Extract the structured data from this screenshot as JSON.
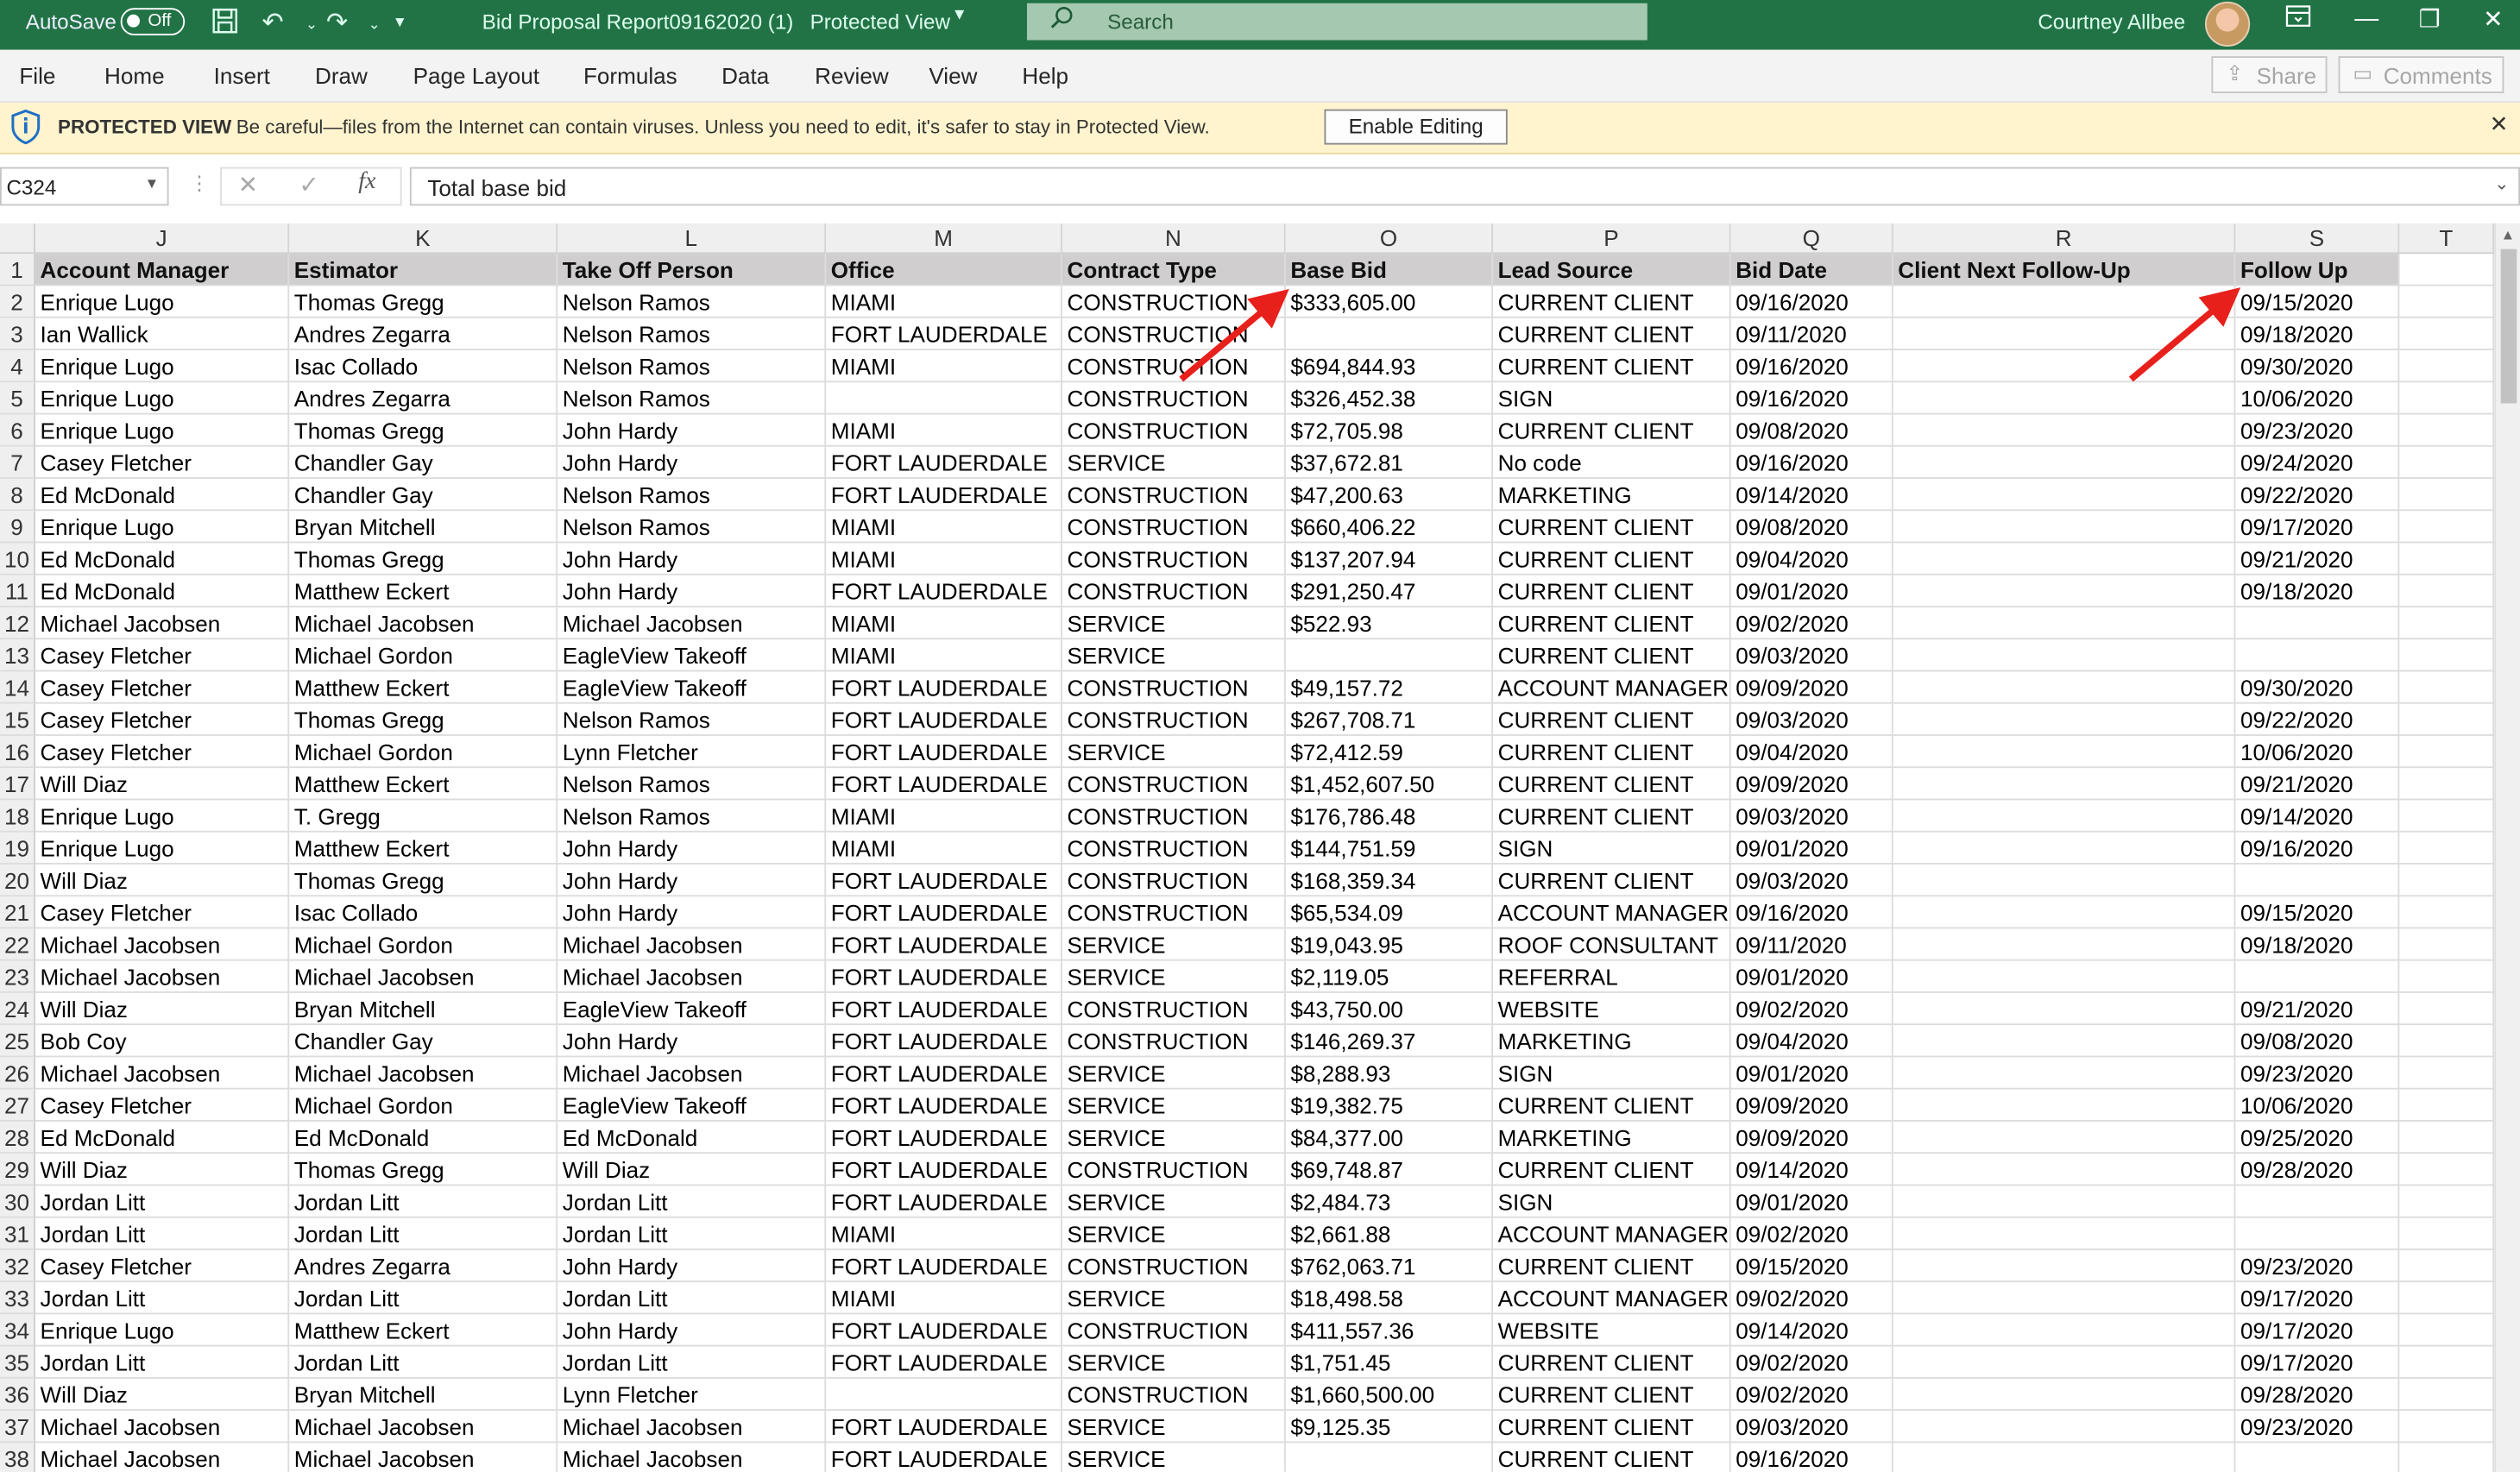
{
  "titlebar": {
    "autosave_label": "AutoSave",
    "autosave_state": "Off",
    "filename": "Bid Proposal Report09162020 (1)",
    "mode": "Protected View",
    "search_placeholder": "Search",
    "user": "Courtney  Allbee"
  },
  "menu": {
    "items": [
      "File",
      "Home",
      "Insert",
      "Draw",
      "Page Layout",
      "Formulas",
      "Data",
      "Review",
      "View",
      "Help"
    ],
    "share": "Share",
    "comments": "Comments"
  },
  "protected_view": {
    "title": "PROTECTED VIEW",
    "message": "Be careful—files from the Internet can contain viruses. Unless you need to edit, it's safer to stay in Protected View.",
    "button": "Enable Editing"
  },
  "formula_bar": {
    "name_box": "C324",
    "fx": "fx",
    "content": "Total base bid"
  },
  "sheet": {
    "columns": [
      "J",
      "K",
      "L",
      "M",
      "N",
      "O",
      "P",
      "Q",
      "R",
      "S",
      "T"
    ],
    "header": [
      "Account Manager",
      "Estimator",
      "Take Off Person",
      "Office",
      "Contract Type",
      "Base Bid",
      "Lead Source",
      "Bid Date",
      "Client Next Follow-Up",
      "Follow Up",
      ""
    ],
    "rows": [
      [
        "Enrique Lugo",
        "Thomas Gregg",
        "Nelson Ramos",
        "MIAMI",
        "CONSTRUCTION",
        "$333,605.00",
        "CURRENT CLIENT",
        "09/16/2020",
        "",
        "09/15/2020"
      ],
      [
        "Ian Wallick",
        "Andres Zegarra",
        "Nelson Ramos",
        "FORT LAUDERDALE",
        "CONSTRUCTION",
        "",
        "CURRENT CLIENT",
        "09/11/2020",
        "",
        "09/18/2020"
      ],
      [
        "Enrique Lugo",
        "Isac Collado",
        "Nelson Ramos",
        "MIAMI",
        "CONSTRUCTION",
        "$694,844.93",
        "CURRENT CLIENT",
        "09/16/2020",
        "",
        "09/30/2020"
      ],
      [
        "Enrique Lugo",
        "Andres Zegarra",
        "Nelson Ramos",
        "",
        "CONSTRUCTION",
        "$326,452.38",
        "SIGN",
        "09/16/2020",
        "",
        "10/06/2020"
      ],
      [
        "Enrique Lugo",
        "Thomas Gregg",
        "John Hardy",
        "MIAMI",
        "CONSTRUCTION",
        "$72,705.98",
        "CURRENT CLIENT",
        "09/08/2020",
        "",
        "09/23/2020"
      ],
      [
        "Casey Fletcher",
        "Chandler Gay",
        "John Hardy",
        "FORT LAUDERDALE",
        "SERVICE",
        "$37,672.81",
        "No code",
        "09/16/2020",
        "",
        "09/24/2020"
      ],
      [
        "Ed McDonald",
        "Chandler Gay",
        "Nelson Ramos",
        "FORT LAUDERDALE",
        "CONSTRUCTION",
        "$47,200.63",
        "MARKETING",
        "09/14/2020",
        "",
        "09/22/2020"
      ],
      [
        "Enrique Lugo",
        "Bryan Mitchell",
        "Nelson Ramos",
        "MIAMI",
        "CONSTRUCTION",
        "$660,406.22",
        "CURRENT CLIENT",
        "09/08/2020",
        "",
        "09/17/2020"
      ],
      [
        "Ed McDonald",
        "Thomas Gregg",
        "John Hardy",
        "MIAMI",
        "CONSTRUCTION",
        "$137,207.94",
        "CURRENT CLIENT",
        "09/04/2020",
        "",
        "09/21/2020"
      ],
      [
        "Ed McDonald",
        "Matthew Eckert",
        "John Hardy",
        "FORT LAUDERDALE",
        "CONSTRUCTION",
        "$291,250.47",
        "CURRENT CLIENT",
        "09/01/2020",
        "",
        "09/18/2020"
      ],
      [
        "Michael Jacobsen",
        "Michael Jacobsen",
        "Michael Jacobsen",
        "MIAMI",
        "SERVICE",
        "$522.93",
        "CURRENT CLIENT",
        "09/02/2020",
        "",
        ""
      ],
      [
        "Casey Fletcher",
        "Michael Gordon",
        "EagleView Takeoff",
        "MIAMI",
        "SERVICE",
        "",
        "CURRENT CLIENT",
        "09/03/2020",
        "",
        ""
      ],
      [
        "Casey Fletcher",
        "Matthew Eckert",
        "EagleView Takeoff",
        "FORT LAUDERDALE",
        "CONSTRUCTION",
        "$49,157.72",
        "ACCOUNT MANAGER",
        "09/09/2020",
        "",
        "09/30/2020"
      ],
      [
        "Casey Fletcher",
        "Thomas Gregg",
        "Nelson Ramos",
        "FORT LAUDERDALE",
        "CONSTRUCTION",
        "$267,708.71",
        "CURRENT CLIENT",
        "09/03/2020",
        "",
        "09/22/2020"
      ],
      [
        "Casey Fletcher",
        "Michael Gordon",
        "Lynn Fletcher",
        "FORT LAUDERDALE",
        "SERVICE",
        "$72,412.59",
        "CURRENT CLIENT",
        "09/04/2020",
        "",
        "10/06/2020"
      ],
      [
        "Will Diaz",
        "Matthew Eckert",
        "Nelson Ramos",
        "FORT LAUDERDALE",
        "CONSTRUCTION",
        "$1,452,607.50",
        "CURRENT CLIENT",
        "09/09/2020",
        "",
        "09/21/2020"
      ],
      [
        "Enrique Lugo",
        "T. Gregg",
        "Nelson Ramos",
        "MIAMI",
        "CONSTRUCTION",
        "$176,786.48",
        "CURRENT CLIENT",
        "09/03/2020",
        "",
        "09/14/2020"
      ],
      [
        "Enrique Lugo",
        "Matthew Eckert",
        "John Hardy",
        "MIAMI",
        "CONSTRUCTION",
        "$144,751.59",
        "SIGN",
        "09/01/2020",
        "",
        "09/16/2020"
      ],
      [
        "Will Diaz",
        "Thomas Gregg",
        "John Hardy",
        "FORT LAUDERDALE",
        "CONSTRUCTION",
        "$168,359.34",
        "CURRENT CLIENT",
        "09/03/2020",
        "",
        ""
      ],
      [
        "Casey Fletcher",
        "Isac Collado",
        "John Hardy",
        "FORT LAUDERDALE",
        "CONSTRUCTION",
        "$65,534.09",
        "ACCOUNT MANAGER",
        "09/16/2020",
        "",
        "09/15/2020"
      ],
      [
        "Michael Jacobsen",
        "Michael Gordon",
        "Michael Jacobsen",
        "FORT LAUDERDALE",
        "SERVICE",
        "$19,043.95",
        "ROOF CONSULTANT",
        "09/11/2020",
        "",
        "09/18/2020"
      ],
      [
        "Michael Jacobsen",
        "Michael Jacobsen",
        "Michael Jacobsen",
        "FORT LAUDERDALE",
        "SERVICE",
        "$2,119.05",
        "REFERRAL",
        "09/01/2020",
        "",
        ""
      ],
      [
        "Will Diaz",
        "Bryan Mitchell",
        "EagleView Takeoff",
        "FORT LAUDERDALE",
        "CONSTRUCTION",
        "$43,750.00",
        "WEBSITE",
        "09/02/2020",
        "",
        "09/21/2020"
      ],
      [
        "Bob Coy",
        "Chandler Gay",
        "John Hardy",
        "FORT LAUDERDALE",
        "CONSTRUCTION",
        "$146,269.37",
        "MARKETING",
        "09/04/2020",
        "",
        "09/08/2020"
      ],
      [
        "Michael Jacobsen",
        "Michael Jacobsen",
        "Michael Jacobsen",
        "FORT LAUDERDALE",
        "SERVICE",
        "$8,288.93",
        "SIGN",
        "09/01/2020",
        "",
        "09/23/2020"
      ],
      [
        "Casey Fletcher",
        "Michael Gordon",
        "EagleView Takeoff",
        "FORT LAUDERDALE",
        "SERVICE",
        "$19,382.75",
        "CURRENT CLIENT",
        "09/09/2020",
        "",
        "10/06/2020"
      ],
      [
        "Ed McDonald",
        "Ed McDonald",
        "Ed McDonald",
        "FORT LAUDERDALE",
        "SERVICE",
        "$84,377.00",
        "MARKETING",
        "09/09/2020",
        "",
        "09/25/2020"
      ],
      [
        "Will Diaz",
        "Thomas Gregg",
        "Will Diaz",
        "FORT LAUDERDALE",
        "CONSTRUCTION",
        "$69,748.87",
        "CURRENT CLIENT",
        "09/14/2020",
        "",
        "09/28/2020"
      ],
      [
        "Jordan Litt",
        "Jordan Litt",
        "Jordan Litt",
        "FORT LAUDERDALE",
        "SERVICE",
        "$2,484.73",
        "SIGN",
        "09/01/2020",
        "",
        ""
      ],
      [
        "Jordan Litt",
        "Jordan Litt",
        "Jordan Litt",
        "MIAMI",
        "SERVICE",
        "$2,661.88",
        "ACCOUNT MANAGER",
        "09/02/2020",
        "",
        ""
      ],
      [
        "Casey Fletcher",
        "Andres Zegarra",
        "John Hardy",
        "FORT LAUDERDALE",
        "CONSTRUCTION",
        "$762,063.71",
        "CURRENT CLIENT",
        "09/15/2020",
        "",
        "09/23/2020"
      ],
      [
        "Jordan Litt",
        "Jordan Litt",
        "Jordan Litt",
        "MIAMI",
        "SERVICE",
        "$18,498.58",
        "ACCOUNT MANAGER",
        "09/02/2020",
        "",
        "09/17/2020"
      ],
      [
        "Enrique Lugo",
        "Matthew Eckert",
        "John Hardy",
        "FORT LAUDERDALE",
        "CONSTRUCTION",
        "$411,557.36",
        "WEBSITE",
        "09/14/2020",
        "",
        "09/17/2020"
      ],
      [
        "Jordan Litt",
        "Jordan Litt",
        "Jordan Litt",
        "FORT LAUDERDALE",
        "SERVICE",
        "$1,751.45",
        "CURRENT CLIENT",
        "09/02/2020",
        "",
        "09/17/2020"
      ],
      [
        "Will Diaz",
        "Bryan Mitchell",
        "Lynn Fletcher",
        "",
        "CONSTRUCTION",
        "$1,660,500.00",
        "CURRENT CLIENT",
        "09/02/2020",
        "",
        "09/28/2020"
      ],
      [
        "Michael Jacobsen",
        "Michael Jacobsen",
        "Michael Jacobsen",
        "FORT LAUDERDALE",
        "SERVICE",
        "$9,125.35",
        "CURRENT CLIENT",
        "09/03/2020",
        "",
        "09/23/2020"
      ],
      [
        "Michael Jacobsen",
        "Michael Jacobsen",
        "Michael Jacobsen",
        "FORT LAUDERDALE",
        "SERVICE",
        "",
        "CURRENT CLIENT",
        "09/16/2020",
        "",
        ""
      ]
    ]
  },
  "colors": {
    "excel_green": "#217346",
    "header_fill": "#d0cece",
    "annotation_arrow": "#e8201c"
  }
}
